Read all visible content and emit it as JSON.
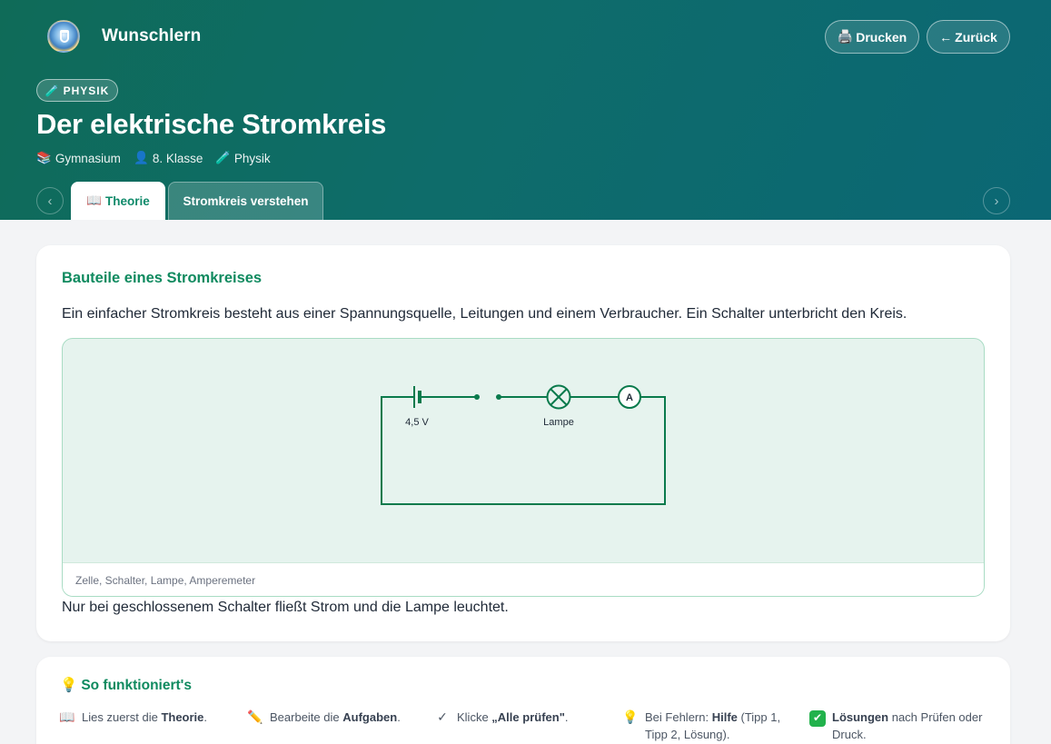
{
  "header": {
    "brand": "Wunschlern",
    "print_icon": "🖨️",
    "print_label": "Drucken",
    "back_icon": "←",
    "back_label": "Zurück",
    "subject_pill_icon": "🧪",
    "subject_pill": "PHYSIK",
    "title": "Der elektrische Stromkreis",
    "meta": [
      {
        "icon": "📚",
        "label": "Gymnasium"
      },
      {
        "icon": "👤",
        "label": "8. Klasse"
      },
      {
        "icon": "🧪",
        "label": "Physik"
      }
    ],
    "nav_prev": "‹",
    "nav_next": "›"
  },
  "tabs": [
    {
      "icon": "📖",
      "label": "Theorie",
      "active": true
    },
    {
      "label": "Stromkreis verstehen",
      "active": false
    }
  ],
  "section": {
    "title": "Bauteile eines Stromkreises",
    "intro": "Ein einfacher Stromkreis besteht aus einer Spannungsquelle, Leitungen und einem Verbraucher. Ein Schalter unterbricht den Kreis.",
    "circuit": {
      "voltage_label": "4,5 V",
      "lamp_label": "Lampe",
      "ammeter_symbol": "A"
    },
    "caption": "Zelle, Schalter, Lampe, Amperemeter",
    "outro": "Nur bei geschlossenem Schalter fließt Strom und die Lampe leuchtet."
  },
  "help": {
    "icon": "💡",
    "title": "So funktioniert's",
    "steps": [
      {
        "icon": "📖",
        "pre": "Lies zuerst die ",
        "bold": "Theorie",
        "post": "."
      },
      {
        "icon": "✏️",
        "pre": "Bearbeite die ",
        "bold": "Aufgaben",
        "post": "."
      },
      {
        "icon": "✓",
        "pre": "Klicke ",
        "bold": "„Alle prüfen\"",
        "post": "."
      },
      {
        "icon": "💡",
        "pre": "Bei Fehlern: ",
        "bold": "Hilfe",
        "post": " (Tipp 1, Tipp 2, Lösung)."
      },
      {
        "icon": "✔",
        "pre": "",
        "bold": "Lösungen",
        "post": " nach Prüfen oder Druck."
      }
    ]
  },
  "colors": {
    "accent": "#0f8a5f",
    "circuit": "#0a7a4c",
    "header_start": "#0f6b58",
    "header_end": "#0b6774"
  }
}
